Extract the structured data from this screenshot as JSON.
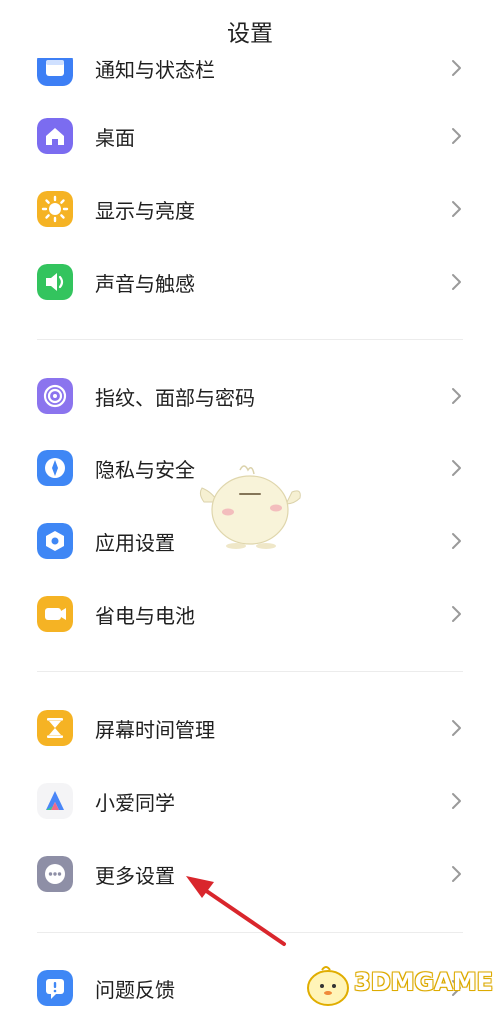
{
  "header": {
    "title": "设置"
  },
  "items": [
    {
      "key": "notifications",
      "label": "通知与状态栏"
    },
    {
      "key": "desktop",
      "label": "桌面"
    },
    {
      "key": "display",
      "label": "显示与亮度"
    },
    {
      "key": "sound",
      "label": "声音与触感"
    },
    {
      "key": "fingerprint",
      "label": "指纹、面部与密码"
    },
    {
      "key": "privacy",
      "label": "隐私与安全"
    },
    {
      "key": "apps",
      "label": "应用设置"
    },
    {
      "key": "battery",
      "label": "省电与电池"
    },
    {
      "key": "screen_time",
      "label": "屏幕时间管理"
    },
    {
      "key": "xiaoai",
      "label": "小爱同学"
    },
    {
      "key": "more",
      "label": "更多设置"
    },
    {
      "key": "feedback",
      "label": "问题反馈"
    }
  ],
  "icons": {
    "notifications": "notification-icon",
    "desktop": "home-icon",
    "display": "sun-icon",
    "sound": "speaker-icon",
    "fingerprint": "fingerprint-icon",
    "privacy": "shield-icon",
    "apps": "app-settings-icon",
    "battery": "battery-icon",
    "screen_time": "hourglass-icon",
    "xiaoai": "xiaoai-icon",
    "more": "more-dots-icon",
    "feedback": "feedback-icon"
  },
  "colors": {
    "notifications": "#3d7ff5",
    "desktop": "#7b6cf0",
    "display": "#f5b324",
    "sound": "#33c45e",
    "fingerprint": "#8b74ee",
    "privacy": "#3f87f5",
    "apps": "#3f87f5",
    "battery": "#f5b324",
    "screen_time": "#f5b324",
    "more": "#8e8fa6",
    "feedback": "#3f87f5",
    "annotation_arrow": "#d9262c"
  },
  "watermark": {
    "text": "3DMGAME"
  }
}
